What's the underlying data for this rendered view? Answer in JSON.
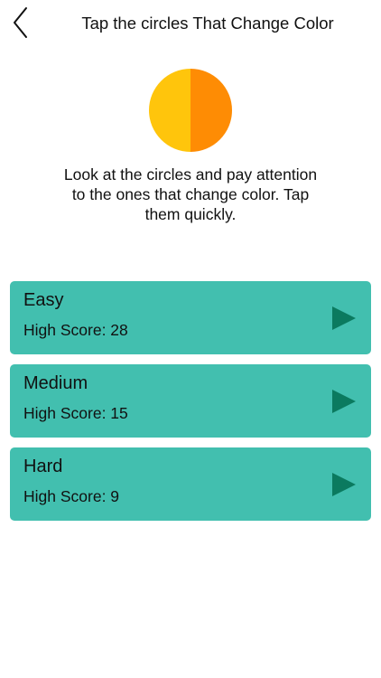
{
  "header": {
    "back_icon": "chevron-left-icon",
    "title": "Tap the circles That Change Color"
  },
  "logo": {
    "icon": "half-circle-icon",
    "color_left": "#ffc50c",
    "color_right": "#fe8c04"
  },
  "instructions": {
    "line1": "Look at the circles and pay attention",
    "line2": "to the ones that change color. Tap",
    "line3": "them quickly."
  },
  "levels": [
    {
      "name": "Easy",
      "score_label": "High Score: 28",
      "icon": "play-icon"
    },
    {
      "name": "Medium",
      "score_label": "High Score: 15",
      "icon": "play-icon"
    },
    {
      "name": "Hard",
      "score_label": "High Score: 9",
      "icon": "play-icon"
    }
  ],
  "colors": {
    "card_background": "#42bfaf",
    "play_icon": "#0b7a5f"
  }
}
